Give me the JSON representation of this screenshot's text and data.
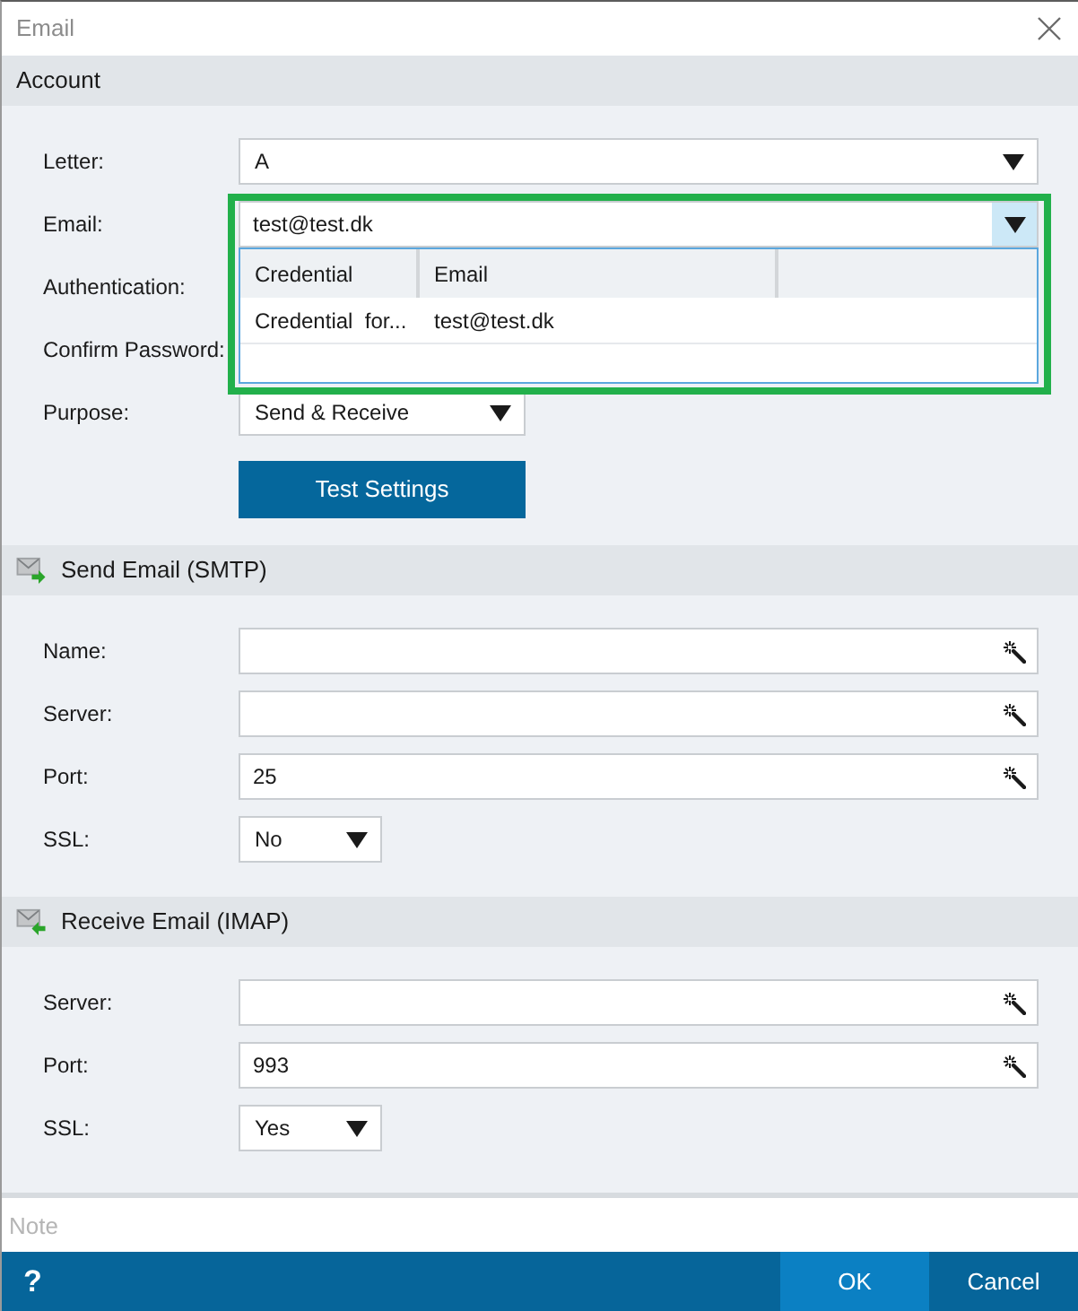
{
  "window": {
    "title": "Email"
  },
  "sections": [
    {
      "kind": "account",
      "title": "Account",
      "fields": [
        {
          "kind": "select",
          "label": "Letter:",
          "value": "A"
        },
        {
          "kind": "combo",
          "label": "Email:",
          "value": "test@test.dk",
          "expanded": true,
          "list": {
            "columns": [
              "Credential",
              "Email"
            ],
            "rows": [
              {
                "cells": [
                  "Credential  for...",
                  "test@test.dk"
                ],
                "selected": false
              }
            ]
          }
        },
        {
          "kind": "covered",
          "label": "Authentication:"
        },
        {
          "kind": "covered",
          "label": "Confirm Password:"
        },
        {
          "kind": "enum",
          "label": "Purpose:",
          "value": "Send & Receive"
        }
      ],
      "button": "Test Settings"
    },
    {
      "kind": "send",
      "title": "Send Email (SMTP)",
      "fields": [
        {
          "kind": "text",
          "label": "Name:"
        },
        {
          "kind": "text",
          "label": "Server:"
        },
        {
          "kind": "text",
          "label": "Port:",
          "value": "25"
        },
        {
          "kind": "boolean",
          "label": "SSL:",
          "value": "No"
        }
      ]
    },
    {
      "kind": "receive",
      "title": "Receive Email (IMAP)",
      "fields": [
        {
          "kind": "text",
          "label": "Server:"
        },
        {
          "kind": "text",
          "label": "Port:",
          "value": "993"
        },
        {
          "kind": "boolean",
          "label": "SSL:",
          "value": "Yes"
        }
      ]
    }
  ],
  "note": {
    "placeholder": "Note"
  },
  "footer": {
    "help": "?",
    "buttons": [
      {
        "label": "OK",
        "default": true
      },
      {
        "label": "Cancel",
        "default": false
      }
    ]
  }
}
